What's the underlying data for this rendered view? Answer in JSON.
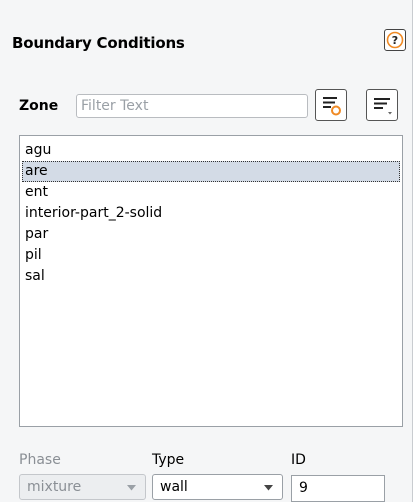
{
  "panel": {
    "title": "Boundary Conditions",
    "help_icon": "help-question-icon"
  },
  "zone": {
    "label": "Zone",
    "filter_placeholder": "Filter Text",
    "filter_value": "",
    "filter_tool_icon": "filter-list-icon",
    "sort_tool_icon": "list-options-icon",
    "items": [
      {
        "label": "agu",
        "selected": false
      },
      {
        "label": "are",
        "selected": true
      },
      {
        "label": "ent",
        "selected": false
      },
      {
        "label": "interior-part_2-solid",
        "selected": false
      },
      {
        "label": "par",
        "selected": false
      },
      {
        "label": "pil",
        "selected": false
      },
      {
        "label": "sal",
        "selected": false
      }
    ]
  },
  "fields": {
    "phase": {
      "label": "Phase",
      "value": "mixture",
      "enabled": false
    },
    "type": {
      "label": "Type",
      "value": "wall"
    },
    "id": {
      "label": "ID",
      "value": "9"
    }
  },
  "colors": {
    "accent_orange": "#f08a24",
    "selection_bg": "#d3dbe6"
  }
}
